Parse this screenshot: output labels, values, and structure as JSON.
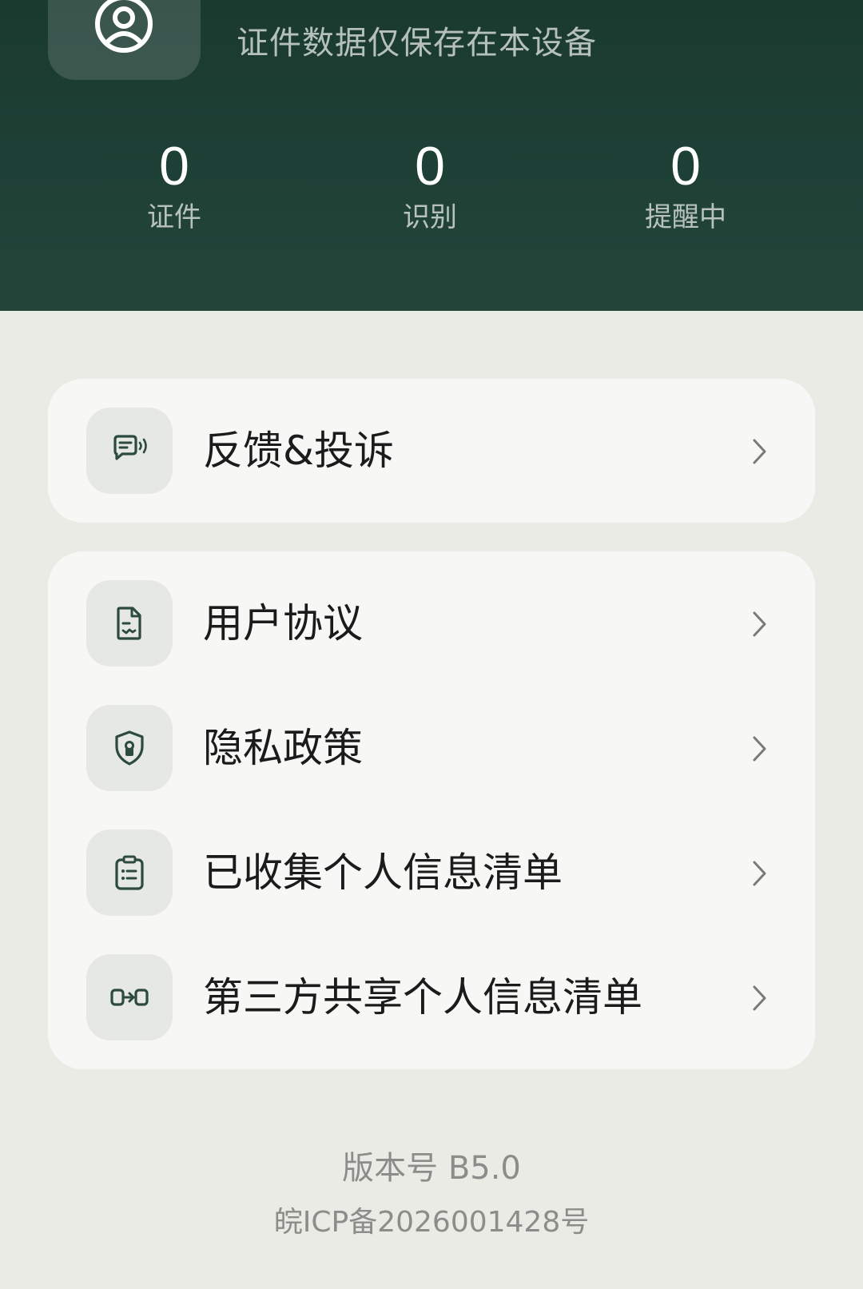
{
  "header": {
    "subtitle": "证件数据仅保存在本设备",
    "stats": [
      {
        "value": "0",
        "label": "证件"
      },
      {
        "value": "0",
        "label": "识别"
      },
      {
        "value": "0",
        "label": "提醒中"
      }
    ]
  },
  "menu": {
    "group1": [
      {
        "label": "反馈&投诉",
        "icon": "feedback-icon"
      }
    ],
    "group2": [
      {
        "label": "用户协议",
        "icon": "document-icon"
      },
      {
        "label": "隐私政策",
        "icon": "shield-lock-icon"
      },
      {
        "label": "已收集个人信息清单",
        "icon": "clipboard-list-icon"
      },
      {
        "label": "第三方共享个人信息清单",
        "icon": "share-transfer-icon"
      }
    ]
  },
  "footer": {
    "version": "版本号 B5.0",
    "icp": "皖ICP备2026001428号"
  },
  "colors": {
    "header_bg": "#1f4036",
    "page_bg": "#ebebe6",
    "card_bg": "#f7f7f5",
    "icon_bg": "#e6e8e4",
    "icon_stroke": "#2c4a40"
  }
}
